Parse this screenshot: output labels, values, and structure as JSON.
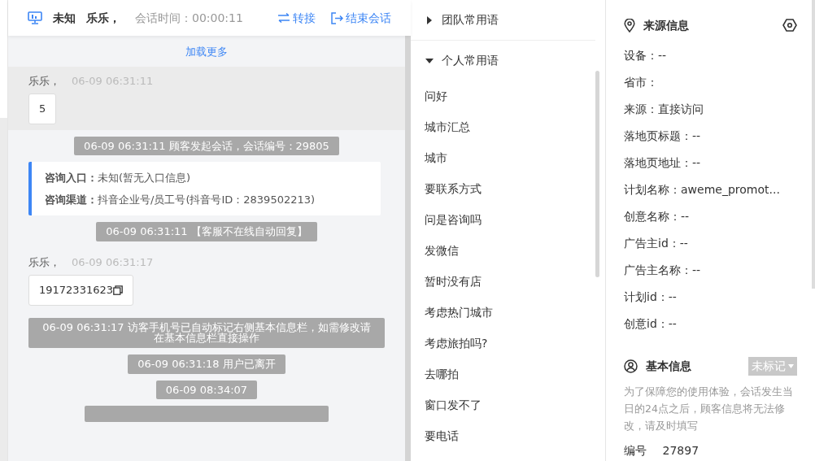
{
  "chat_header": {
    "device_label": "未知",
    "customer_name": "乐乐，",
    "duration_label": "会话时间：",
    "duration": "00:00:11",
    "actions": [
      {
        "kind": "transfer",
        "label": "转接"
      },
      {
        "kind": "end",
        "label": "结束会话"
      }
    ]
  },
  "load_more": "加载更多",
  "messages": [
    {
      "kind": "customer",
      "sender": "乐乐，",
      "time": "06-09 06:31:11",
      "text": "5",
      "highlighted": true,
      "copyable": false
    },
    {
      "kind": "system",
      "text": "06-09 06:31:11 顾客发起会话，会话编号：29805"
    },
    {
      "kind": "info",
      "lines": [
        {
          "label": "咨询入口：",
          "value": "未知(暂无入口信息)"
        },
        {
          "label": "咨询渠道：",
          "value": "抖音企业号/员工号(抖音号ID：2839502213)"
        }
      ]
    },
    {
      "kind": "system",
      "text": "06-09 06:31:11 【客服不在线自动回复】"
    },
    {
      "kind": "customer",
      "sender": "乐乐，",
      "time": "06-09 06:31:17",
      "text": "19172331623",
      "highlighted": false,
      "copyable": true
    },
    {
      "kind": "system",
      "text": "06-09 06:31:17 访客手机号已自动标记右侧基本信息栏，如需修改请在基本信息栏直接操作"
    },
    {
      "kind": "system",
      "text": "06-09 06:31:18 用户已离开"
    },
    {
      "kind": "system",
      "text": "06-09 08:34:07"
    }
  ],
  "phrase_groups": [
    {
      "title": "团队常用语",
      "expanded": false
    },
    {
      "title": "个人常用语",
      "expanded": true,
      "items": [
        "问好",
        "城市汇总",
        "城市",
        "要联系方式",
        "问是咨询吗",
        "发微信",
        "暂时没有店",
        "考虑热门城市",
        "考虑旅拍吗?",
        "去哪拍",
        "窗口发不了",
        "要电话"
      ]
    }
  ],
  "source_info": {
    "title": "来源信息",
    "fields": [
      "设备：--",
      "省市：",
      "来源：直接访问",
      "落地页标题：--",
      "落地页地址：--",
      "计划名称：aweme_promot...",
      "创意名称：--",
      "广告主id：--",
      "广告主名称：--",
      "计划id：--",
      "创意id：--"
    ]
  },
  "basic_info": {
    "title": "基本信息",
    "tag": "未标记",
    "note": "为了保障您的使用体验，会话发生当日的24点之后，顾客信息将无法修改，请及时填写",
    "fields": [
      {
        "label": "编号",
        "value": "27897"
      }
    ]
  }
}
